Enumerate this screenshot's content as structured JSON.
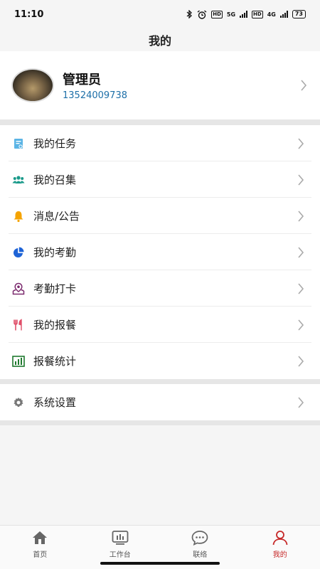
{
  "status_bar": {
    "time": "11:10",
    "hd_tag": "HD",
    "net_5g": "5G",
    "net_4g": "4G",
    "battery": "73"
  },
  "header": {
    "title": "我的"
  },
  "profile": {
    "name": "管理员",
    "phone": "13524009738"
  },
  "menu": {
    "items": [
      {
        "label": "我的任务",
        "icon": "task-icon",
        "color": "#5bb4e5"
      },
      {
        "label": "我的召集",
        "icon": "group-icon",
        "color": "#1a9a8a"
      },
      {
        "label": "消息/公告",
        "icon": "bell-icon",
        "color": "#f5a300"
      },
      {
        "label": "我的考勤",
        "icon": "pie-chart-icon",
        "color": "#1e63d6"
      },
      {
        "label": "考勤打卡",
        "icon": "location-checkin-icon",
        "color": "#7b2a6e"
      },
      {
        "label": "我的报餐",
        "icon": "fork-knife-icon",
        "color": "#e0506a"
      },
      {
        "label": "报餐统计",
        "icon": "bar-chart-icon",
        "color": "#1f7a2e"
      }
    ],
    "settings": {
      "label": "系统设置",
      "icon": "gear-icon",
      "color": "#777777"
    }
  },
  "tab_bar": {
    "tabs": [
      {
        "label": "首页",
        "icon": "home-icon"
      },
      {
        "label": "工作台",
        "icon": "workbench-icon"
      },
      {
        "label": "联络",
        "icon": "chat-icon"
      },
      {
        "label": "我的",
        "icon": "user-icon",
        "active": true
      }
    ]
  }
}
